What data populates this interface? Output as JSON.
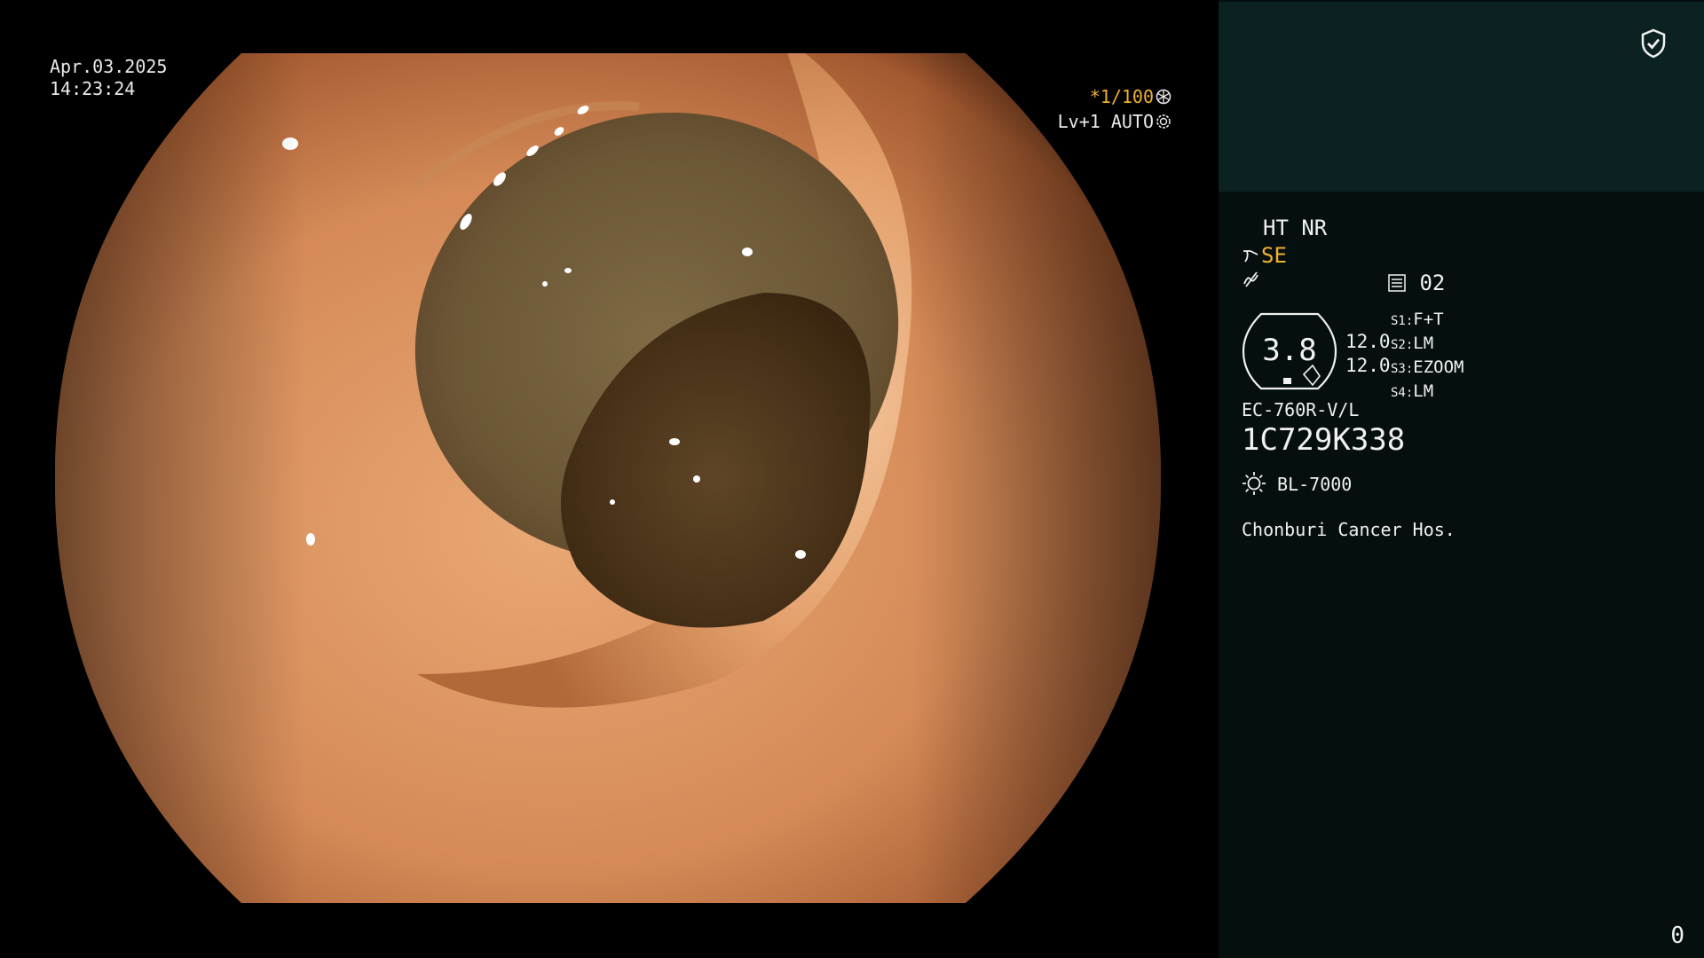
{
  "overlay": {
    "date": "Apr.03.2025",
    "time": "14:23:24",
    "shutter": "*1/100",
    "level": "Lv+1 AUTO"
  },
  "panel": {
    "mode": "HT NR",
    "enhancement": "SE",
    "memory": "02",
    "magnification": "3.8",
    "value_1": "12.0",
    "value_2": "12.0",
    "switches": [
      {
        "key": "S1:",
        "value": "F+T"
      },
      {
        "key": "S2:",
        "value": "LM"
      },
      {
        "key": "S3:",
        "value": "EZOOM"
      },
      {
        "key": "S4:",
        "value": "LM"
      }
    ],
    "scope_model": "EC-760R-V/L",
    "serial": "1C729K338",
    "light_source": "BL-7000",
    "hospital": "Chonburi Cancer Hos.",
    "counter": "0"
  },
  "colors": {
    "accent": "#f0b030",
    "panel_bg": "#060f0f",
    "panel_top_bg": "#0c2222"
  },
  "icons": [
    "shield-check-icon",
    "aperture-icon",
    "gear-icon",
    "scope-tip-icon",
    "filter-icon",
    "memory-icon",
    "light-icon"
  ]
}
